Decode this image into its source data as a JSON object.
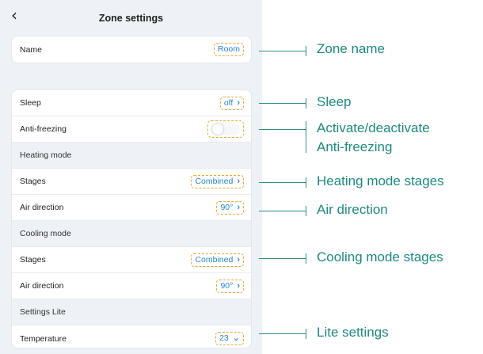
{
  "header": {
    "back_glyph": "‹",
    "title": "Zone settings"
  },
  "name_row": {
    "label": "Name",
    "value": "Room"
  },
  "rows": {
    "sleep": {
      "label": "Sleep",
      "value": "off"
    },
    "anti_freezing": {
      "label": "Anti-freezing",
      "toggle_on": false
    },
    "heating_section": "Heating mode",
    "heating_stages": {
      "label": "Stages",
      "value": "Combined"
    },
    "heating_air": {
      "label": "Air direction",
      "value": "90°"
    },
    "cooling_section": "Cooling mode",
    "cooling_stages": {
      "label": "Stages",
      "value": "Combined"
    },
    "cooling_air": {
      "label": "Air direction",
      "value": "90°"
    },
    "lite_section": "Settings Lite",
    "temperature": {
      "label": "Temperature",
      "value": "23"
    }
  },
  "annotations": {
    "zone_name": "Zone name",
    "sleep": "Sleep",
    "anti_freezing_1": "Activate/deactivate",
    "anti_freezing_2": "Anti-freezing",
    "heating_stages": "Heating mode stages",
    "air_direction": "Air direction",
    "cooling_stages": "Cooling mode stages",
    "lite_settings": "Lite settings"
  },
  "colors": {
    "accent": "#2a86d6",
    "highlight_dash": "#f2a533",
    "annotation": "#1f8a80",
    "panel_bg": "#eef1f5"
  },
  "icons": {
    "back": "chevron-left-icon",
    "row_arrow": "chevron-right-icon",
    "dropdown": "chevron-down-icon"
  }
}
